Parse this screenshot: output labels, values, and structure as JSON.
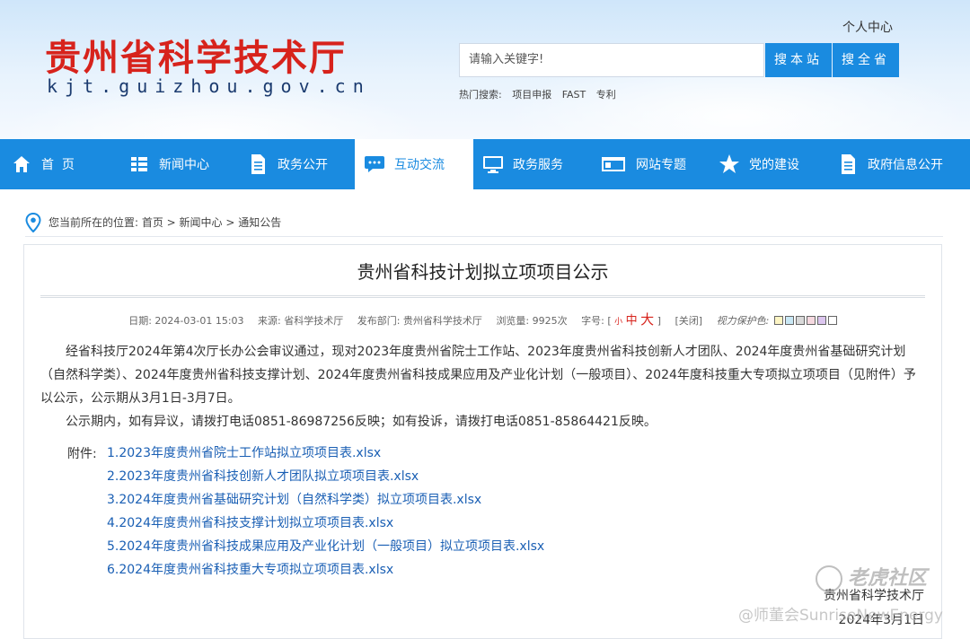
{
  "header": {
    "title": "贵州省科学技术厅",
    "url": "kjt.guizhou.gov.cn",
    "personal_center": "个人中心",
    "search_placeholder": "请输入关键字!",
    "search_site_label": "搜本站",
    "search_gov_label": "搜全省",
    "hot_label": "热门搜索:",
    "hot_terms": [
      "项目申报",
      "FAST",
      "专利"
    ]
  },
  "nav": {
    "items": [
      {
        "label": "首  页",
        "icon": "home-icon"
      },
      {
        "label": "新闻中心",
        "icon": "list-icon"
      },
      {
        "label": "政务公开",
        "icon": "document-icon"
      },
      {
        "label": "互动交流",
        "icon": "chat-bubble-icon"
      },
      {
        "label": "政务服务",
        "icon": "monitor-icon"
      },
      {
        "label": "网站专题",
        "icon": "window-icon"
      },
      {
        "label": "党的建设",
        "icon": "star-icon"
      },
      {
        "label": "政府信息公开",
        "icon": "document-icon"
      }
    ],
    "active_index": 3
  },
  "breadcrumb": {
    "text": "您当前所在的位置: 首页 > 新闻中心 > 通知公告"
  },
  "article": {
    "title": "贵州省科技计划拟立项项目公示",
    "meta": {
      "date": "日期: 2024-03-01 15:03",
      "source": "来源: 省科学技术厅",
      "department": "发布部门: 贵州省科学技术厅",
      "views": "浏览量: 9925次",
      "font_size_label": "字号: [",
      "font_small": "小",
      "font_mid": "中",
      "font_big": "大",
      "font_size_close": "]",
      "close": "[关闭]",
      "eye_protect": "视力保护色:",
      "swatch_colors": [
        "#fdf5c4",
        "#c9e8f5",
        "#d9d9d9",
        "#f5d9e0",
        "#dcc6ef",
        "#ffffff"
      ]
    },
    "paragraph1": "经省科技厅2024年第4次厅长办公会审议通过，现对2023年度贵州省院士工作站、2023年度贵州省科技创新人才团队、2024年度贵州省基础研究计划（自然科学类）、2024年度贵州省科技支撑计划、2024年度贵州省科技成果应用及产业化计划（一般项目）、2024年度科技重大专项拟立项项目（见附件）予以公示，公示期从3月1日-3月7日。",
    "paragraph2": "公示期内，如有异议，请拨打电话0851-86987256反映；如有投诉，请拨打电话0851-85864421反映。",
    "attachment_label": "附件:",
    "attachments": [
      "1.2023年度贵州省院士工作站拟立项项目表.xlsx",
      "2.2023年度贵州省科技创新人才团队拟立项项目表.xlsx",
      "3.2024年度贵州省基础研究计划（自然科学类）拟立项项目表.xlsx",
      "4.2024年度贵州省科技支撑计划拟立项项目表.xlsx",
      "5.2024年度贵州省科技成果应用及产业化计划（一般项目）拟立项项目表.xlsx",
      "6.2024年度贵州省科技重大专项拟立项项目表.xlsx"
    ],
    "signature_org": "贵州省科学技术厅",
    "signature_date": "2024年3月1日"
  },
  "watermark": {
    "brand": "老虎社区",
    "author": "@师董会SunriseNewEnergy"
  }
}
